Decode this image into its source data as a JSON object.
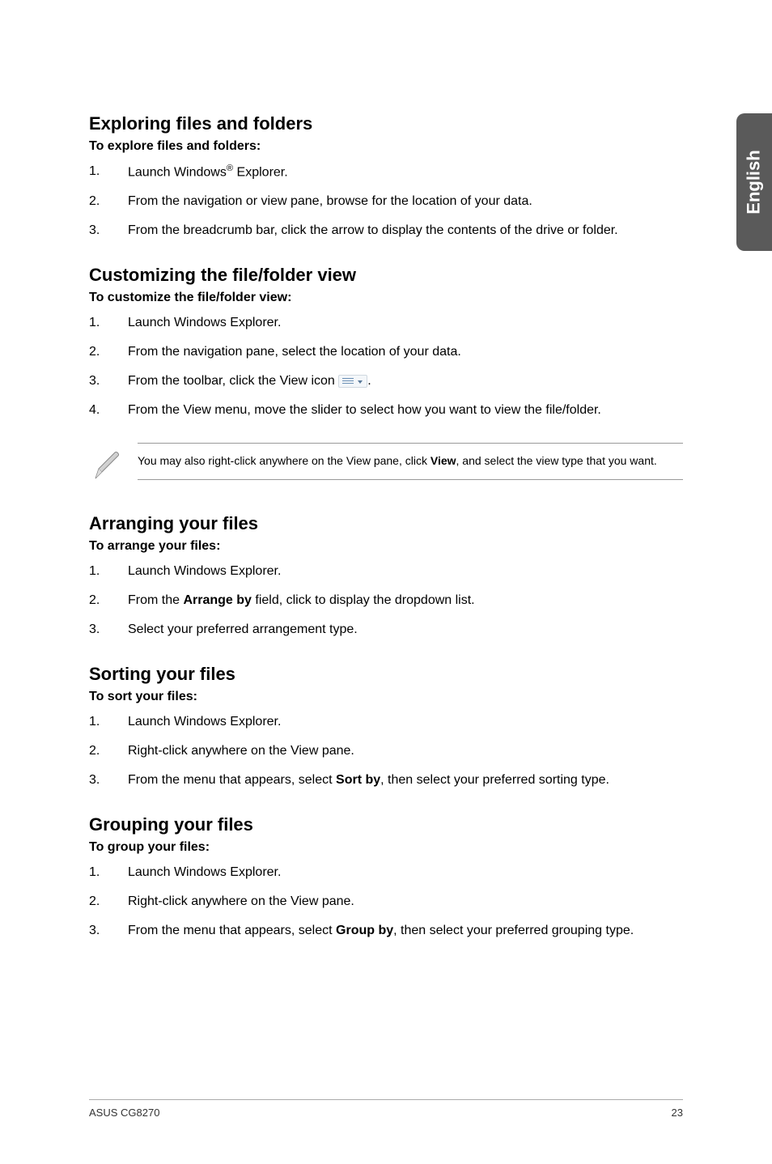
{
  "side_tab": "English",
  "sections": {
    "exploring": {
      "title": "Exploring files and folders",
      "lead": "To explore files and folders:",
      "steps": [
        {
          "pre": "Launch Windows",
          "sup": "®",
          "post": " Explorer."
        },
        {
          "text": "From the navigation or view pane, browse for the location of your data."
        },
        {
          "text": "From the breadcrumb bar, click the arrow to display the contents of the drive or folder."
        }
      ]
    },
    "customizing": {
      "title": "Customizing the file/folder view",
      "lead": "To customize the file/folder view:",
      "steps": [
        {
          "text": "Launch Windows Explorer."
        },
        {
          "text": "From the navigation pane, select the location of your data."
        },
        {
          "pre": "From the toolbar, click the View icon ",
          "icon": true,
          "post": "."
        },
        {
          "text": "From the View menu, move the slider to select how you want to view the file/folder."
        }
      ],
      "note": {
        "pre": "You may also right-click anywhere on the View pane, click ",
        "bold": "View",
        "post": ", and select the view type that you want."
      }
    },
    "arranging": {
      "title": "Arranging your files",
      "lead": "To arrange your files:",
      "steps": [
        {
          "text": "Launch Windows Explorer."
        },
        {
          "pre": "From the ",
          "bold": "Arrange by",
          "post": " field, click to display the dropdown list."
        },
        {
          "text": "Select your preferred arrangement type."
        }
      ]
    },
    "sorting": {
      "title": "Sorting your files",
      "lead": "To sort your files:",
      "steps": [
        {
          "text": "Launch Windows Explorer."
        },
        {
          "text": "Right-click anywhere on the View pane."
        },
        {
          "pre": "From the menu that appears, select ",
          "bold": "Sort by",
          "post": ", then select your preferred sorting type."
        }
      ]
    },
    "grouping": {
      "title": "Grouping your files",
      "lead": "To group your files:",
      "steps": [
        {
          "text": "Launch Windows Explorer."
        },
        {
          "text": "Right-click anywhere on the View pane."
        },
        {
          "pre": "From the menu that appears, select ",
          "bold": "Group by",
          "post": ", then select your preferred grouping type."
        }
      ]
    }
  },
  "footer": {
    "left": "ASUS CG8270",
    "right": "23"
  }
}
